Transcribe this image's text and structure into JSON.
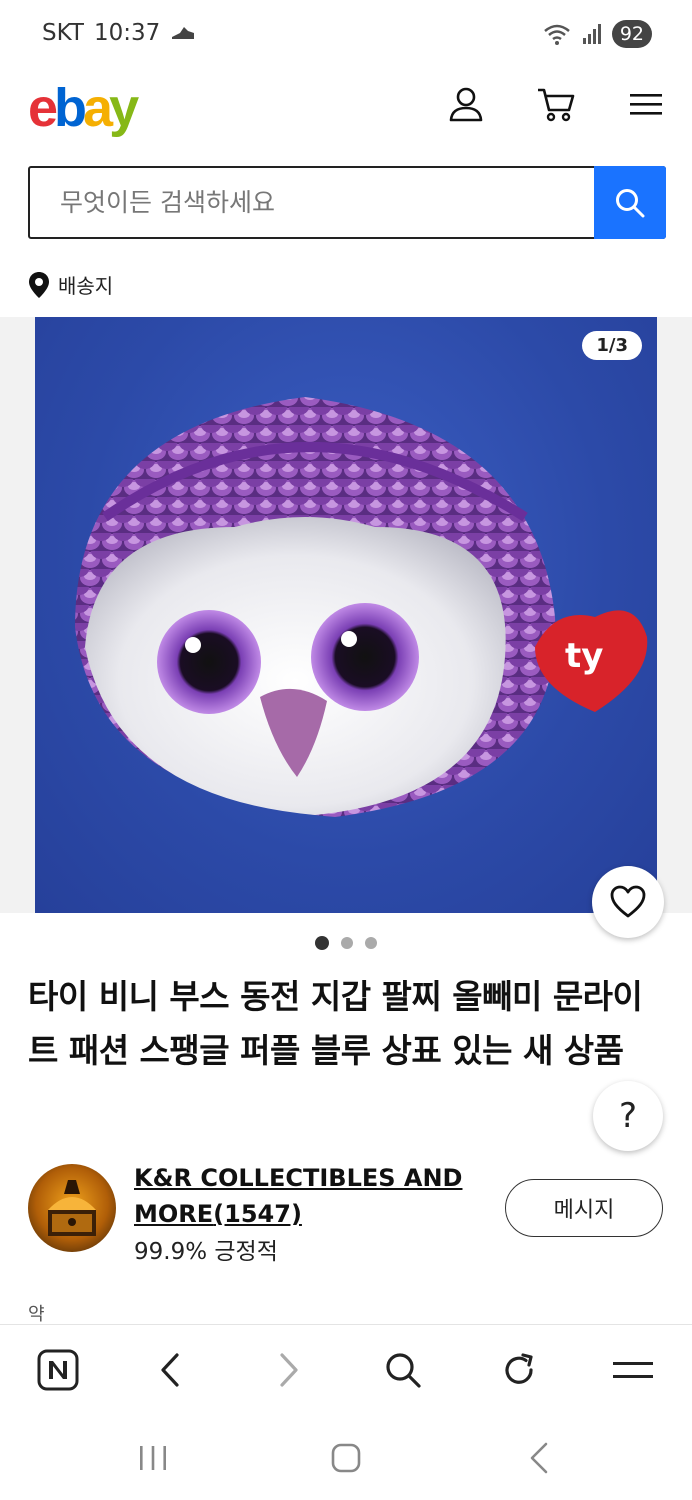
{
  "status_bar": {
    "carrier": "SKT",
    "time": "10:37",
    "battery": "92"
  },
  "header": {
    "logo": {
      "e": "e",
      "b": "b",
      "a": "a",
      "y": "y"
    }
  },
  "search": {
    "placeholder": "무엇이든 검색하세요"
  },
  "ship_to": {
    "label": "배송지"
  },
  "gallery": {
    "counter": "1/3",
    "dots": 3,
    "active_dot": 0
  },
  "listing": {
    "title": "타이 비니 부스 동전 지갑 팔찌 올빼미 문라이트 패션 스팽글 퍼플 블루 상표 있는 새 상품"
  },
  "help": {
    "label": "?"
  },
  "seller": {
    "name": "K&R COLLECTIBLES AND MORE",
    "feedback_count": "(1547)",
    "rating": "99.9% 긍정적",
    "message_button": "메시지"
  },
  "cutoff_text": "약",
  "colors": {
    "search_button": "#1a73ff",
    "logo_e": "#e53238",
    "logo_b": "#0064d2",
    "logo_a": "#f5af02",
    "logo_y": "#86b817"
  }
}
